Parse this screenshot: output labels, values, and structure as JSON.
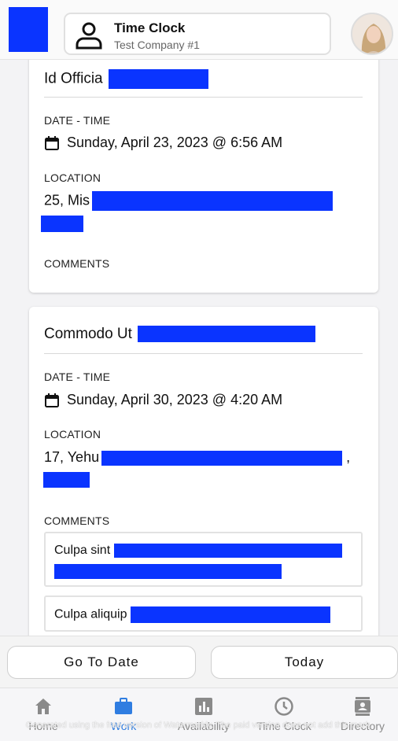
{
  "header": {
    "title": "Time Clock",
    "subtitle": "Test Company #1"
  },
  "entries": [
    {
      "title": "Id Officia",
      "date_time_label": "DATE - TIME",
      "date_time": "Sunday, April 23, 2023 @ 6:56 AM",
      "location_label": "LOCATION",
      "location": "25, Mis",
      "comments_label": "COMMENTS",
      "comments": []
    },
    {
      "title": "Commodo Ut",
      "date_time_label": "DATE - TIME",
      "date_time": "Sunday, April 30, 2023 @ 4:20 AM",
      "location_label": "LOCATION",
      "location": "17, Yehu",
      "location_suffix": ",",
      "comments_label": "COMMENTS",
      "comments": [
        "Culpa sint",
        "Culpa aliquip"
      ]
    }
  ],
  "actions": {
    "go_to_date": "Go To Date",
    "today": "Today"
  },
  "tabs": [
    {
      "label": "Home",
      "icon": "home-icon"
    },
    {
      "label": "Work",
      "icon": "briefcase-icon",
      "active": true
    },
    {
      "label": "Availability",
      "icon": "bar-chart-icon"
    },
    {
      "label": "Time Clock",
      "icon": "clock-icon"
    },
    {
      "label": "Directory",
      "icon": "contacts-icon"
    }
  ],
  "watermark": "Generated using the free version of Watermarkly. The paid version does not add this mark.",
  "colors": {
    "redaction": "#0a34ff",
    "active_tab": "#2f7de1",
    "inactive_tab": "#8a8a8a"
  }
}
